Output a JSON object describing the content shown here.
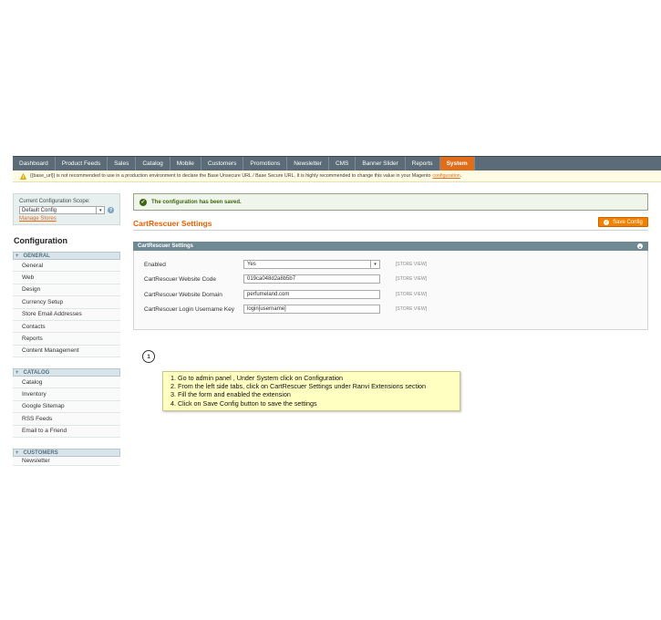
{
  "nav": {
    "items": [
      "Dashboard",
      "Product Feeds",
      "Sales",
      "Catalog",
      "Mobile",
      "Customers",
      "Promotions",
      "Newsletter",
      "CMS",
      "Banner Slider",
      "Reports",
      "System"
    ],
    "active": "System"
  },
  "warning": {
    "text": "{{base_url}} is not recommended to use in a production environment to declare the Base Unsecure URL / Base Secure URL. It is highly recommended to change this value in your Magento",
    "link": "configuration",
    "suffix": "."
  },
  "scope": {
    "label": "Current Configuration Scope:",
    "value": "Default Config",
    "manage": "Manage Stores"
  },
  "sidebar": {
    "title": "Configuration",
    "groups": [
      {
        "title": "GENERAL",
        "items": [
          "General",
          "Web",
          "Design",
          "Currency Setup",
          "Store Email Addresses",
          "Contacts",
          "Reports",
          "Content Management"
        ]
      },
      {
        "title": "CATALOG",
        "items": [
          "Catalog",
          "Inventory",
          "Google Sitemap",
          "RSS Feeds",
          "Email to a Friend"
        ]
      },
      {
        "title": "CUSTOMERS",
        "items": [
          "Newsletter"
        ]
      }
    ]
  },
  "message": {
    "saved": "The configuration has been saved."
  },
  "page": {
    "title": "CartRescuer Settings",
    "save_label": "Save Config"
  },
  "section": {
    "title": "CartRescuer Settings",
    "fields": [
      {
        "label": "Enabled",
        "value": "Yes",
        "scope": "[STORE VIEW]"
      },
      {
        "label": "CartRescuer Website Code",
        "value": "019ca048d2a8b5b7",
        "scope": "[STORE VIEW]"
      },
      {
        "label": "CartRescuer Website Domain",
        "value": "perfumeland.com",
        "scope": "[STORE VIEW]"
      },
      {
        "label": "CartRescuer Login Username Key",
        "value": "login[username]",
        "scope": "[STORE VIEW]"
      }
    ]
  },
  "instructions": {
    "step_number": "1",
    "lines": [
      "1. Go to admin panel , Under System click on Configuration",
      "2. From the left side tabs, click on CartRescuer Settings under Ranvi Extensions section",
      "3. Fill the form and enabled the extension",
      "4. Click on Save Config button to save the settings"
    ]
  },
  "colors": {
    "accent": "#eb5e00",
    "nav_bg": "#5b6b77",
    "success": "#3d6611"
  }
}
